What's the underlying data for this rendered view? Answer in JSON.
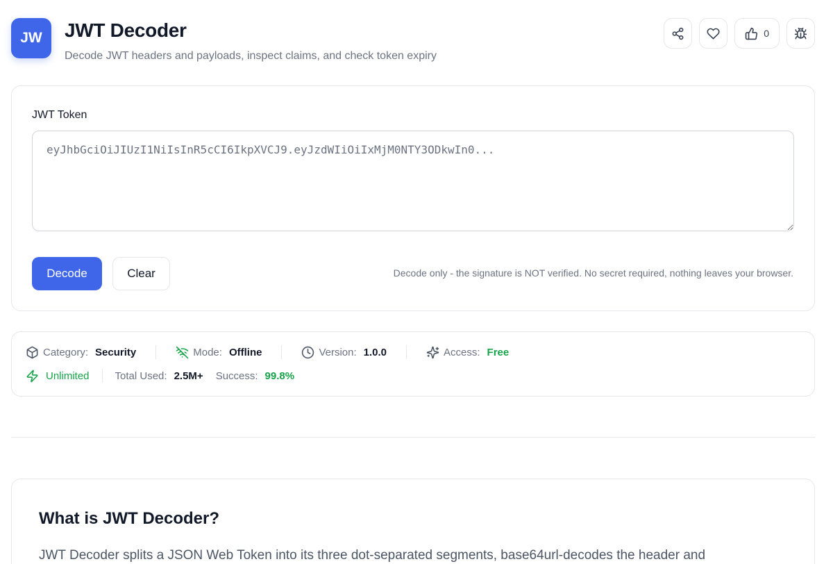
{
  "app": {
    "logo_text": "JW",
    "title": "JWT Decoder",
    "subtitle": "Decode JWT headers and payloads, inspect claims, and check token expiry",
    "accent_color": "#3f66e8"
  },
  "header_actions": {
    "share_icon": "share-icon",
    "favorite_icon": "heart-icon",
    "like_icon": "thumbs-up-icon",
    "like_count": "0",
    "report_icon": "bug-icon"
  },
  "token_form": {
    "label": "JWT Token",
    "placeholder": "eyJhbGciOiJIUzI1NiIsInR5cCI6IkpXVCJ9.eyJzdWIiOiIxMjM0NTY3ODkwIn0...",
    "value": "",
    "decode_label": "Decode",
    "clear_label": "Clear",
    "note": "Decode only - the signature is NOT verified. No secret required, nothing leaves your browser."
  },
  "meta": {
    "category_label": "Category:",
    "category_value": "Security",
    "mode_label": "Mode:",
    "mode_value": "Offline",
    "version_label": "Version:",
    "version_value": "1.0.0",
    "access_label": "Access:",
    "access_value": "Free",
    "limit_value": "Unlimited",
    "total_label": "Total Used:",
    "total_value": "2.5M+",
    "success_label": "Success:",
    "success_value": "99.8%",
    "green_color": "#16a34a"
  },
  "about": {
    "title": "What is JWT Decoder?",
    "text": "JWT Decoder splits a JSON Web Token into its three dot-separated segments, base64url-decodes the header and"
  }
}
